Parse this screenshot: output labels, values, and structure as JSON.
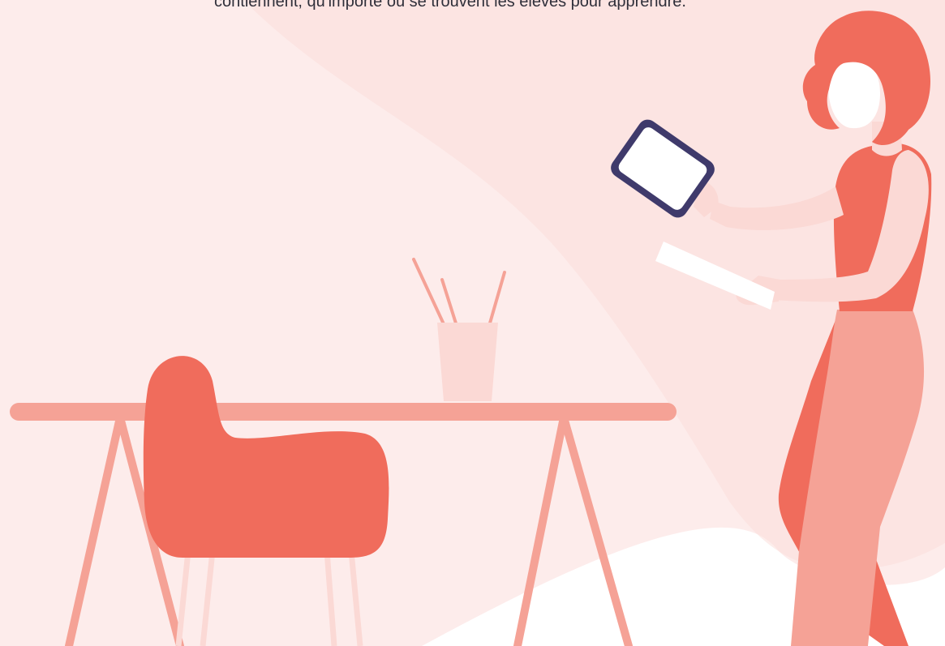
{
  "caption": {
    "text": "contiennent, qu'importe où se trouvent les élèves pour apprendre."
  },
  "palette": {
    "background_blob": "#fdeceb",
    "background_light": "#fef5f4",
    "coral": "#f06c5c",
    "salmon": "#f5a296",
    "pale_pink": "#fbd9d5",
    "tablet_frame": "#3f3a6b",
    "white": "#ffffff"
  },
  "illustration": {
    "scene": "woman-with-tablet-desk-chair",
    "icons": [
      "desk-icon",
      "chair-icon",
      "pencil-cup-icon",
      "tablet-icon",
      "woman-figure-icon"
    ]
  }
}
